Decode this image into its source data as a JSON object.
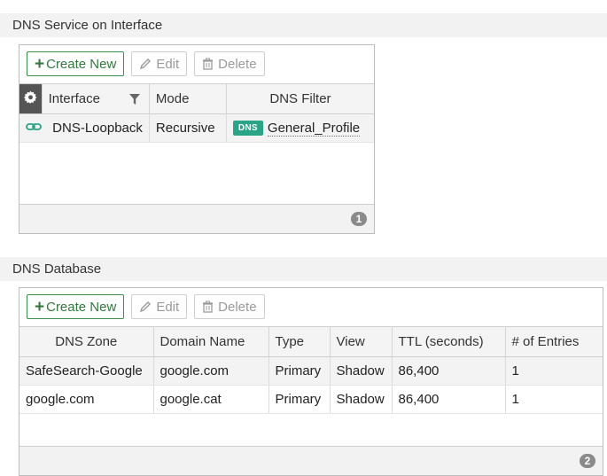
{
  "section1": {
    "title": "DNS Service on Interface",
    "toolbar": {
      "create": "Create New",
      "edit": "Edit",
      "delete": "Delete"
    },
    "columns": {
      "interface": "Interface",
      "mode": "Mode",
      "dns_filter": "DNS Filter"
    },
    "rows": [
      {
        "interface": "DNS-Loopback",
        "mode": "Recursive",
        "badge": "DNS",
        "filter": "General_Profile"
      }
    ],
    "count": "1"
  },
  "section2": {
    "title": "DNS Database",
    "toolbar": {
      "create": "Create New",
      "edit": "Edit",
      "delete": "Delete"
    },
    "columns": [
      "DNS Zone",
      "Domain Name",
      "Type",
      "View",
      "TTL (seconds)",
      "# of Entries"
    ],
    "rows": [
      [
        "SafeSearch-Google",
        "google.com",
        "Primary",
        "Shadow",
        "86,400",
        "1"
      ],
      [
        "google.com",
        "google.cat",
        "Primary",
        "Shadow",
        "86,400",
        "1"
      ]
    ],
    "count": "2"
  },
  "colors": {
    "accent_green": "#2f7a3c",
    "badge_green": "#2aa486"
  },
  "icons": [
    "plus-icon",
    "pencil-icon",
    "trash-icon",
    "gear-icon",
    "filter-icon",
    "link-icon"
  ]
}
